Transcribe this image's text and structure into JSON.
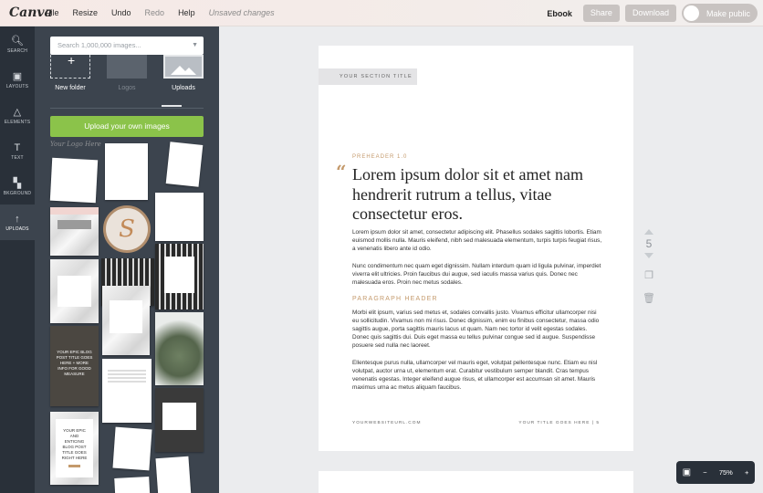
{
  "app": {
    "logo": "Canva",
    "menu": [
      "File",
      "Resize",
      "Undo",
      "Redo",
      "Help"
    ],
    "status": "Unsaved changes"
  },
  "header": {
    "doc_type": "Ebook",
    "share_label": "Share",
    "download_label": "Download",
    "public_label": "Make public"
  },
  "rail": [
    {
      "label": "SEARCH",
      "icon": "search-icon"
    },
    {
      "label": "LAYOUTS",
      "icon": "layouts-icon"
    },
    {
      "label": "ELEMENTS",
      "icon": "elements-icon"
    },
    {
      "label": "TEXT",
      "icon": "text-icon"
    },
    {
      "label": "BKGROUND",
      "icon": "background-icon"
    },
    {
      "label": "UPLOADS",
      "icon": "upload-arrow-icon"
    }
  ],
  "panel": {
    "search_placeholder": "Search 1,000,000 images...",
    "folders": [
      "New folder",
      "Logos",
      "Uploads"
    ],
    "upload_button": "Upload your own images",
    "script_label": "Your Logo Here",
    "thumb_texts": {
      "blog1": "YOUR EPIC BLOG POST TITLE GOES HERE + MORE INFO FOR GOOD MEASURE",
      "blog2": "YOUR EPIC AND ENTICING BLOG POST TITLE GOES RIGHT HERE",
      "seal": "S",
      "seal_ring": "YOUR SUBNAME GOES HERE"
    }
  },
  "page": {
    "section_title": "YOUR SECTION TITLE",
    "preheader": "PREHEADER 1.0",
    "quote_mark": "“",
    "headline": "Lorem ipsum dolor sit et amet nam hendrerit rutrum a tellus, vitae consectetur eros.",
    "para1": "Lorem ipsum dolor sit amet, consectetur adipiscing elit. Phasellus sodales sagittis lobortis. Etiam euismod mollis nulla. Mauris eleifend, nibh sed malesuada elementum, turpis turpis feugiat risus, a venenatis libero ante id odio.",
    "para2": "Nunc condimentum nec quam eget dignissim. Nullam interdum quam id ligula pulvinar, imperdiet viverra elit ultricies. Proin faucibus dui augue, sed iaculis massa varius quis. Donec nec malesuada eros. Proin nec metus sodales.",
    "paragraph_header": "PARAGRAPH HEADER",
    "para3": "Morbi elit ipsum, varius sed metus et, sodales convallis justo. Vivamus efficitur ullamcorper nisi eu sollicitudin. Vivamus non mi risus. Donec dignissim, enim eu finibus consectetur, massa odio sagittis augue, porta sagittis mauris lacus ut quam. Nam nec tortor id velit egestas sodales. Donec quis sagittis dui. Duis eget massa eu tellus pulvinar congue sed id augue. Suspendisse posuere sed nulla nec laoreet.",
    "para4": "Ellentesque purus nulla, ullamcorper vel mauris eget, volutpat pellentesque nunc. Etiam eu nisl volutpat, auctor urna ut, elementum erat. Curabitur vestibulum semper blandit. Cras tempus venenatis egestas. Integer eleifend augue risus, et ullamcorper est accumsan sit amet. Mauris maximus urna ac metus aliquam faucibus.",
    "footer_url": "YOURWEBSITEURL.COM",
    "footer_title": "YOUR TITLE GOES HERE | 5"
  },
  "page_tools": {
    "page_number": "5"
  },
  "zoom": {
    "level": "75%",
    "minus": "−",
    "plus": "+"
  }
}
